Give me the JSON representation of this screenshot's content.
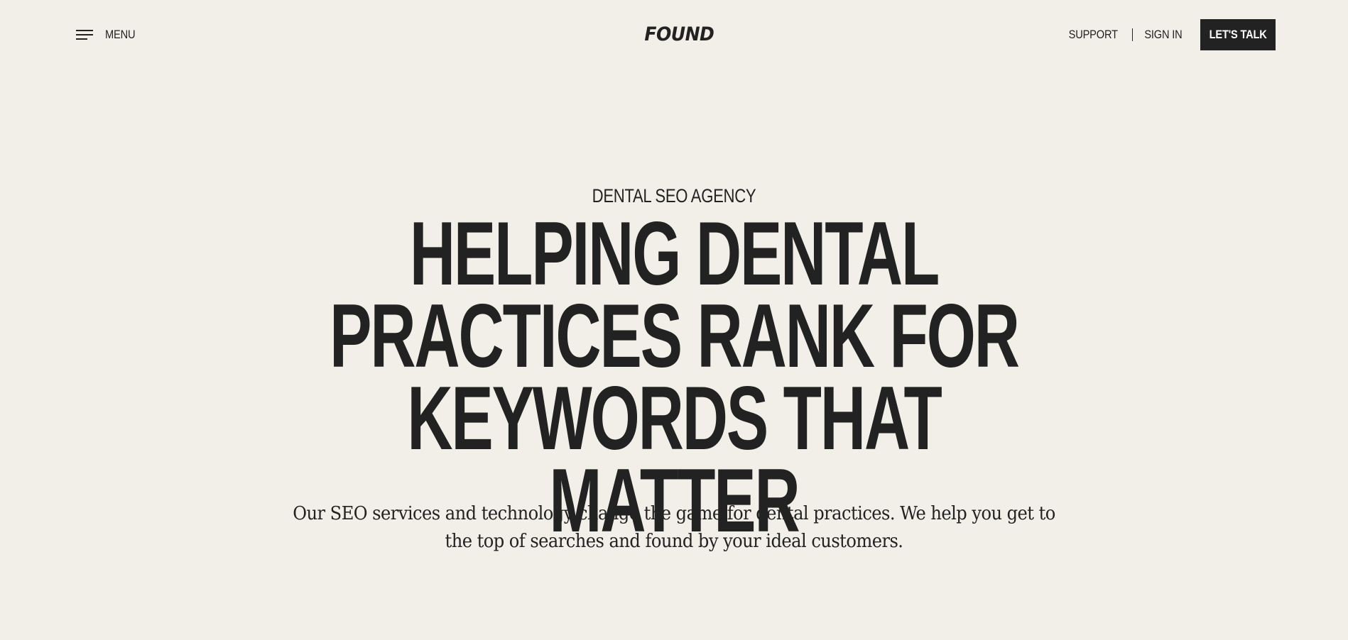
{
  "header": {
    "menu_label": "MENU",
    "logo_text": "FOUND",
    "nav_links": [
      {
        "label": "SUPPORT"
      },
      {
        "label": "SIGN IN"
      }
    ],
    "cta_label": "LET'S TALK"
  },
  "hero": {
    "eyebrow": "DENTAL SEO AGENCY",
    "headline": "HELPING DENTAL PRACTICES RANK FOR KEYWORDS THAT MATTER",
    "description": "Our SEO services and technology change the game for dental practices. We help you get to the top of searches and found by your ideal customers."
  },
  "icons": {
    "menu_icon": "hamburger-menu-icon"
  },
  "colors": {
    "background": "#f1efe7",
    "text": "#222222",
    "cta_background": "#222222",
    "cta_text": "#ffffff"
  }
}
